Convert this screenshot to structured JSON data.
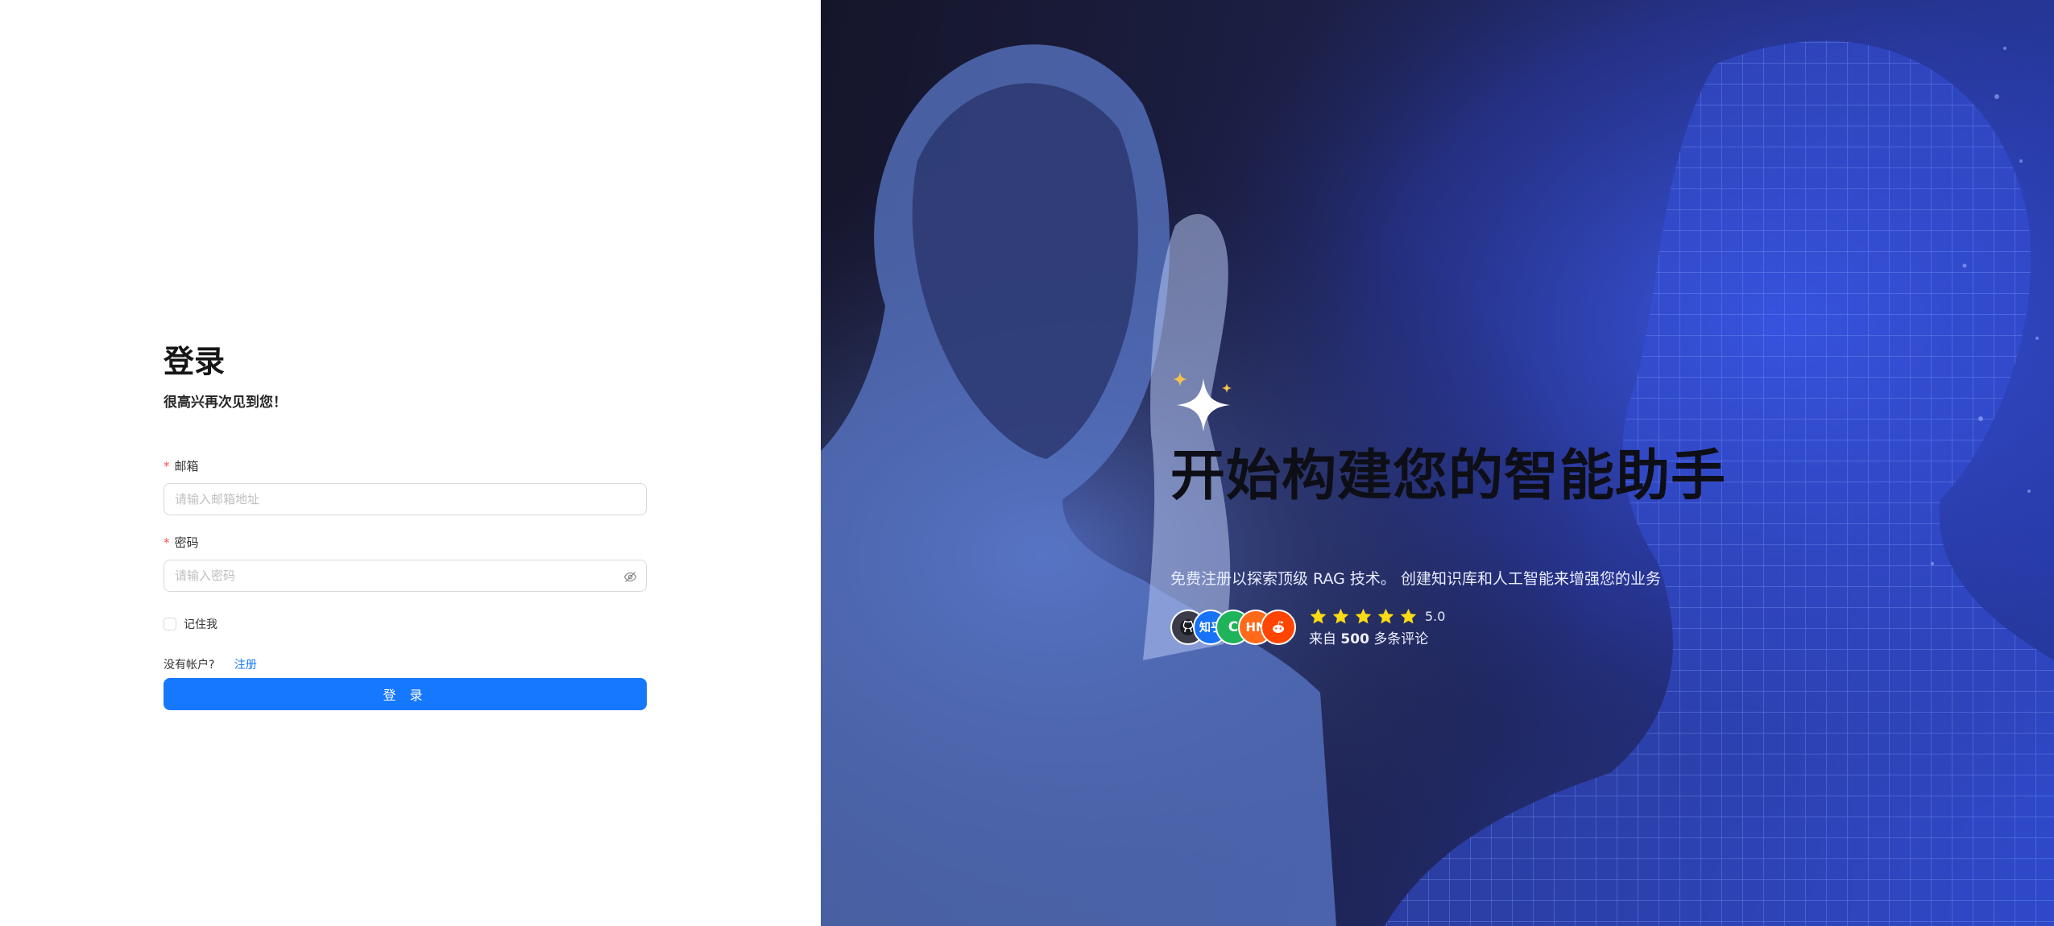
{
  "login": {
    "title": "登录",
    "subtitle": "很高兴再次见到您！",
    "email_label": "邮箱",
    "email_placeholder": "请输入邮箱地址",
    "email_value": "",
    "password_label": "密码",
    "password_placeholder": "请输入密码",
    "password_value": "",
    "required_mark": "*",
    "remember_label": "记住我",
    "remember_checked": false,
    "no_account_text": "没有帐户?",
    "signup_link": "注册",
    "submit_label": "登 录"
  },
  "hero": {
    "headline": "开始构建您的智能助手",
    "description": "免费注册以探索顶级 RAG 技术。 创建知识库和人工智能来增强您的业务",
    "rating": {
      "stars": 5,
      "score": "5.0"
    },
    "reviews_prefix": "来自",
    "reviews_count": "500",
    "reviews_suffix": "多条评论",
    "avatars": [
      {
        "name": "github-avatar",
        "text": "",
        "color": "#3b3b4a"
      },
      {
        "name": "zhihu-avatar",
        "text": "知乎",
        "color": "#1772f6"
      },
      {
        "name": "green-avatar",
        "text": "C",
        "color": "#1fb35a"
      },
      {
        "name": "hn-avatar",
        "text": "HN",
        "color": "#ff6a1a"
      },
      {
        "name": "reddit-avatar",
        "text": "",
        "color": "#ff4500"
      }
    ]
  },
  "colors": {
    "primary": "#1677ff",
    "required": "#ff4d4f",
    "star": "#fadb14",
    "sparkle_accent": "#f2c14e"
  },
  "icons": {
    "password_toggle": "eye-invisible-icon",
    "sparkle": "sparkle-icon",
    "star": "star-icon"
  }
}
